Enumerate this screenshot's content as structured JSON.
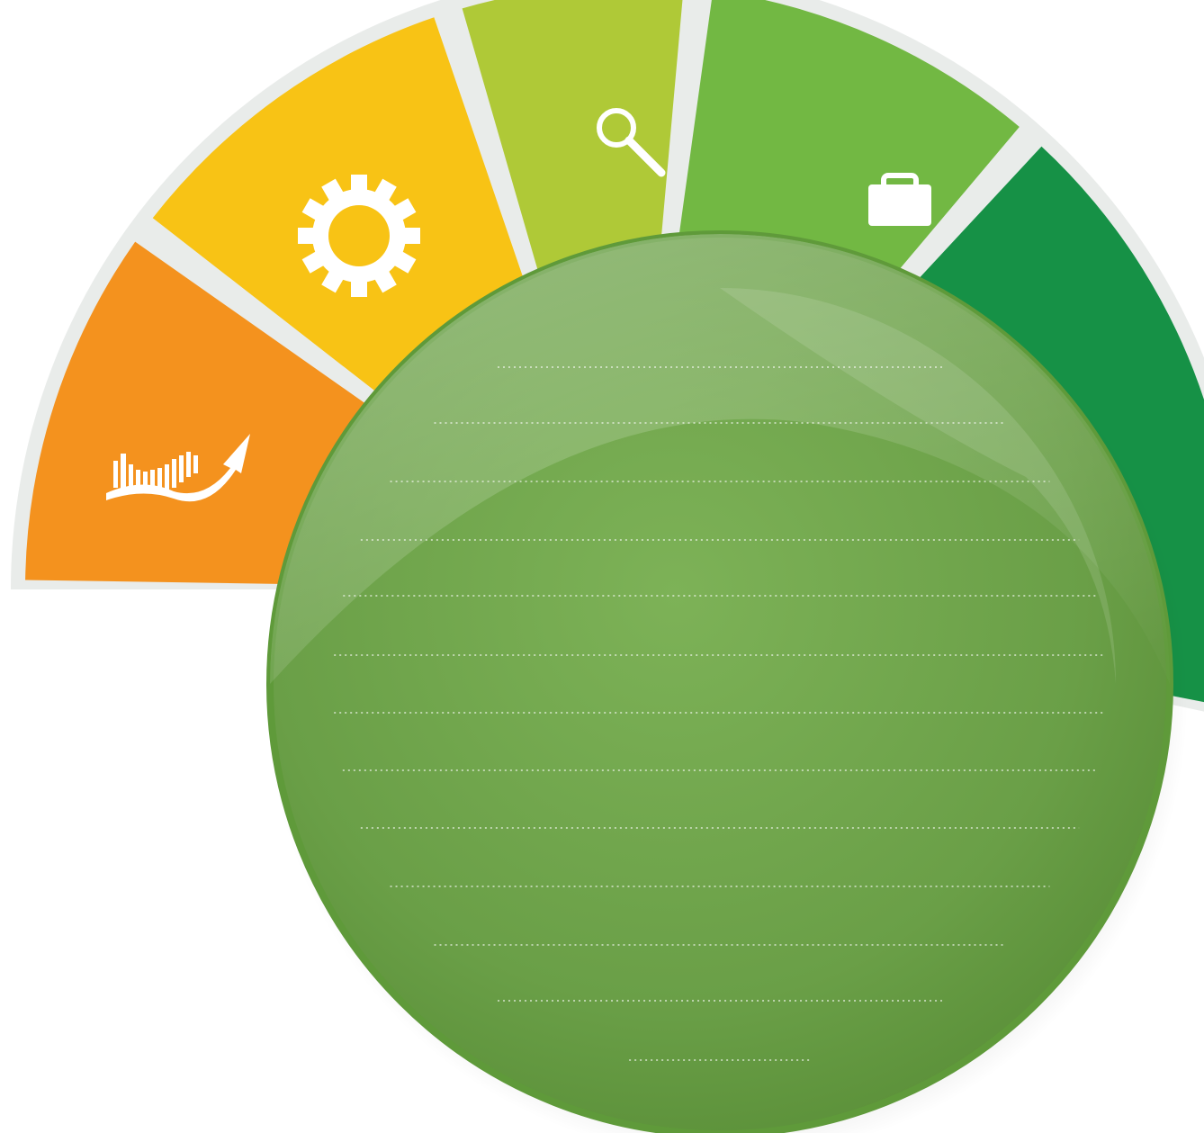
{
  "diagram": {
    "segments": [
      {
        "id": "segment-growth",
        "color": "#F4921E",
        "icon": "growth-chart-icon"
      },
      {
        "id": "segment-settings",
        "color": "#F8C315",
        "icon": "gear-icon"
      },
      {
        "id": "segment-search",
        "color": "#AFC937",
        "icon": "magnifier-icon"
      },
      {
        "id": "segment-business",
        "color": "#72B843",
        "icon": "briefcase-icon"
      },
      {
        "id": "segment-dark",
        "color": "#169146",
        "icon": ""
      }
    ],
    "ring_border_color": "#E9ECEA",
    "circle": {
      "base_color": "#6FA64A",
      "highlight_color": "#A4CB82",
      "rim_color": "#5F9A3A"
    },
    "text_lines": [
      "",
      "",
      "",
      "",
      "",
      "",
      "",
      "",
      "",
      "",
      "",
      "",
      ""
    ]
  }
}
